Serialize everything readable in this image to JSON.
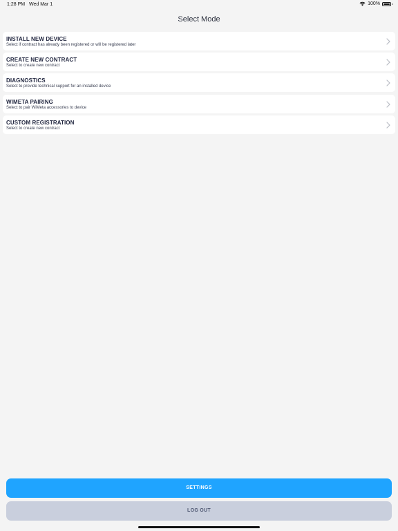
{
  "status_bar": {
    "time": "1:28 PM",
    "date": "Wed Mar 1",
    "battery": "100%"
  },
  "header": {
    "title": "Select Mode"
  },
  "modes": [
    {
      "title": "INSTALL NEW DEVICE",
      "subtitle": "Select if contract has already been registered or will be registered later"
    },
    {
      "title": "CREATE NEW CONTRACT",
      "subtitle": "Select to create new contract"
    },
    {
      "title": "DIAGNOSTICS",
      "subtitle": "Select to provide technical support for an installed device"
    },
    {
      "title": "WIMETA PAIRING",
      "subtitle": "Select to pair WiMeta accessories to device"
    },
    {
      "title": "CUSTOM REGISTRATION",
      "subtitle": "Select to create new contract"
    }
  ],
  "footer": {
    "settings_label": "SETTINGS",
    "logout_label": "LOG OUT"
  },
  "colors": {
    "background": "#f4f4f4",
    "primary": "#1fa4ff",
    "secondary": "#c9cfdd"
  }
}
